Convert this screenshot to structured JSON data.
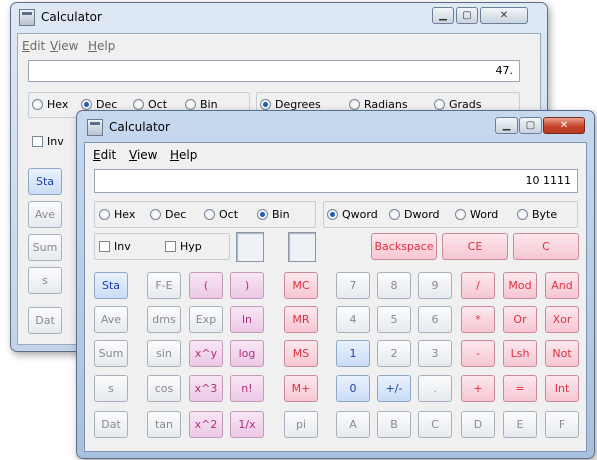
{
  "back_window": {
    "title": "Calculator",
    "menus": [
      {
        "label": "Edit",
        "key": "E",
        "rest": "dit"
      },
      {
        "label": "View",
        "key": "V",
        "rest": "iew"
      },
      {
        "label": "Help",
        "key": "H",
        "rest": "elp"
      }
    ],
    "display": "47.",
    "bases": [
      "Hex",
      "Dec",
      "Oct",
      "Bin"
    ],
    "selected_base": "Dec",
    "angles": [
      "Degrees",
      "Radians",
      "Grads"
    ],
    "selected_angle": "Degrees",
    "inv_label": "Inv",
    "side_buttons": [
      "Sta",
      "Ave",
      "Sum",
      "s",
      "Dat"
    ]
  },
  "front_window": {
    "title": "Calculator",
    "menus": [
      {
        "label": "Edit",
        "key": "E",
        "rest": "dit"
      },
      {
        "label": "View",
        "key": "V",
        "rest": "iew"
      },
      {
        "label": "Help",
        "key": "H",
        "rest": "elp"
      }
    ],
    "display": "10 1111",
    "bases": [
      "Hex",
      "Dec",
      "Oct",
      "Bin"
    ],
    "selected_base": "Bin",
    "word_sizes": [
      "Qword",
      "Dword",
      "Word",
      "Byte"
    ],
    "selected_word": "Qword",
    "inv_label": "Inv",
    "hyp_label": "Hyp",
    "top_buttons": [
      "Backspace",
      "CE",
      "C"
    ],
    "rows": [
      [
        "Sta",
        "F-E",
        "(",
        ")",
        "MC",
        "7",
        "8",
        "9",
        "/",
        "Mod",
        "And"
      ],
      [
        "Ave",
        "dms",
        "Exp",
        "ln",
        "MR",
        "4",
        "5",
        "6",
        "*",
        "Or",
        "Xor"
      ],
      [
        "Sum",
        "sin",
        "x^y",
        "log",
        "MS",
        "1",
        "2",
        "3",
        "-",
        "Lsh",
        "Not"
      ],
      [
        "s",
        "cos",
        "x^3",
        "n!",
        "M+",
        "0",
        "+/-",
        ".",
        "+",
        "=",
        "Int"
      ],
      [
        "Dat",
        "tan",
        "x^2",
        "1/x",
        "pi",
        "A",
        "B",
        "C",
        "D",
        "E",
        "F"
      ]
    ]
  },
  "colors": {
    "accent_red": "#e03040",
    "accent_blue": "#1f3fa8",
    "accent_purple": "#b0307a",
    "frame_glass": "#b9cde6"
  }
}
